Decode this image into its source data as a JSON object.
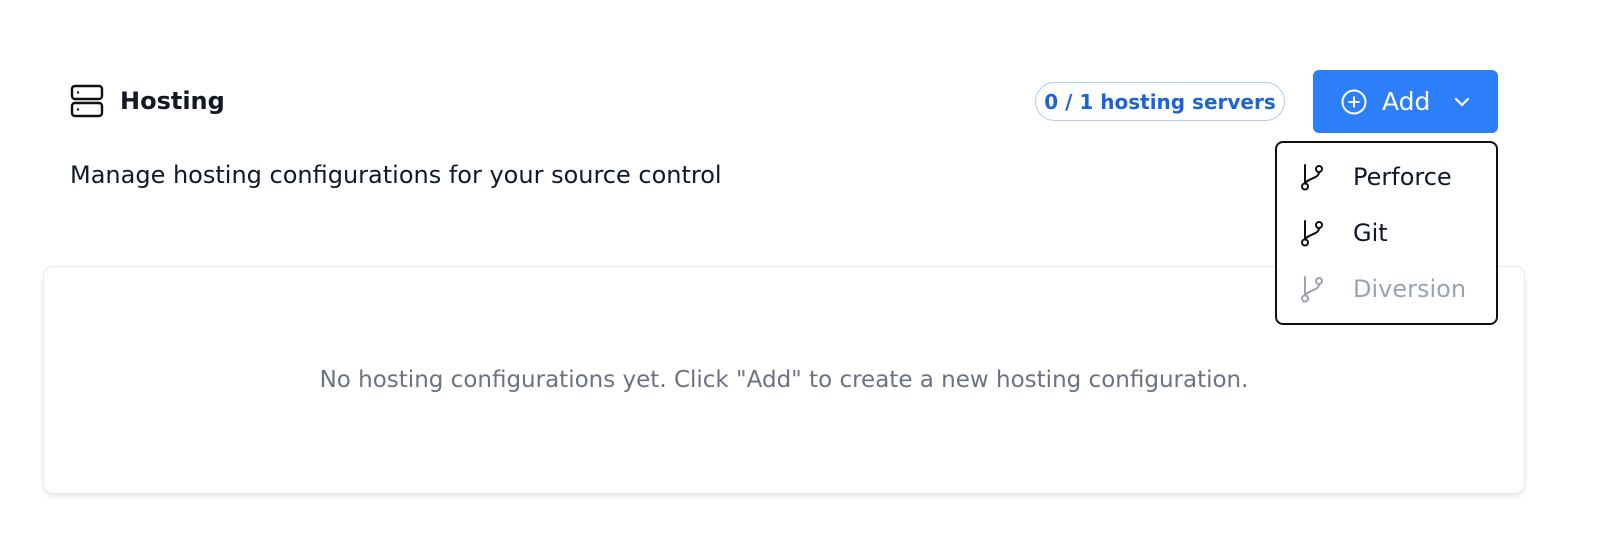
{
  "header": {
    "title": "Hosting",
    "icon": "server-icon",
    "subtitle": "Manage hosting configurations for your source control"
  },
  "counter": {
    "label": "0 / 1 hosting servers",
    "used": 0,
    "total": 1
  },
  "add_button": {
    "label": "Add",
    "icon": "plus-circle-icon",
    "trailing_icon": "chevron-down-icon"
  },
  "dropdown": {
    "open": true,
    "items": [
      {
        "label": "Perforce",
        "icon": "git-branch-icon",
        "disabled": false
      },
      {
        "label": "Git",
        "icon": "git-branch-icon",
        "disabled": false
      },
      {
        "label": "Diversion",
        "icon": "git-branch-icon",
        "disabled": true
      }
    ]
  },
  "empty_state": {
    "message": "No hosting configurations yet. Click \"Add\" to create a new hosting configuration."
  },
  "colors": {
    "accent": "#2d7ff9",
    "badge_text": "#1d63d8",
    "badge_border": "#a9cdf5",
    "muted_text": "#6b7280",
    "disabled_text": "#9ca3af"
  }
}
